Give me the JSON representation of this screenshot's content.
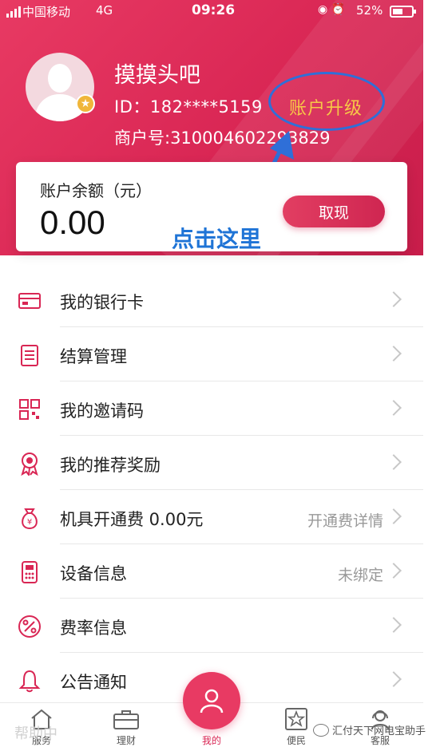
{
  "status_bar": {
    "carrier": "中国移动",
    "network": "4G",
    "time": "09:26",
    "battery": "52%"
  },
  "profile": {
    "name": "摸摸头吧",
    "id": "ID：182****5159",
    "merchant_no": "商户号:310004602293829",
    "upgrade_label": "账户升级"
  },
  "balance": {
    "label": "账户余额（元）",
    "amount": "0.00",
    "withdraw_label": "取现"
  },
  "annotation": {
    "text": "点击这里"
  },
  "menu": [
    {
      "label": "我的银行卡",
      "hint": "",
      "icon": "bank-card-icon"
    },
    {
      "label": "结算管理",
      "hint": "",
      "icon": "document-list-icon"
    },
    {
      "label": "我的邀请码",
      "hint": "",
      "icon": "qr-code-icon"
    },
    {
      "label": "我的推荐奖励",
      "hint": "",
      "icon": "award-medal-icon"
    },
    {
      "label": "机具开通费 0.00元",
      "hint": "开通费详情",
      "icon": "money-bag-icon"
    },
    {
      "label": "设备信息",
      "hint": "未绑定",
      "icon": "pos-device-icon"
    },
    {
      "label": "费率信息",
      "hint": "",
      "icon": "percent-icon"
    },
    {
      "label": "公告通知",
      "hint": "",
      "icon": "bell-icon"
    }
  ],
  "tabs": [
    {
      "label": "服务",
      "icon": "home-icon"
    },
    {
      "label": "理财",
      "icon": "briefcase-icon"
    },
    {
      "label": "我的",
      "icon": "user-icon"
    },
    {
      "label": "便民",
      "icon": "star-icon"
    },
    {
      "label": "客服",
      "icon": "headset-icon"
    }
  ],
  "ghost_text": "帮助中",
  "watermark": "汇付天下网电宝助手",
  "colors": {
    "brand": "#d92654",
    "upgrade_text": "#f7c847",
    "annotation": "#2f6fd8"
  }
}
